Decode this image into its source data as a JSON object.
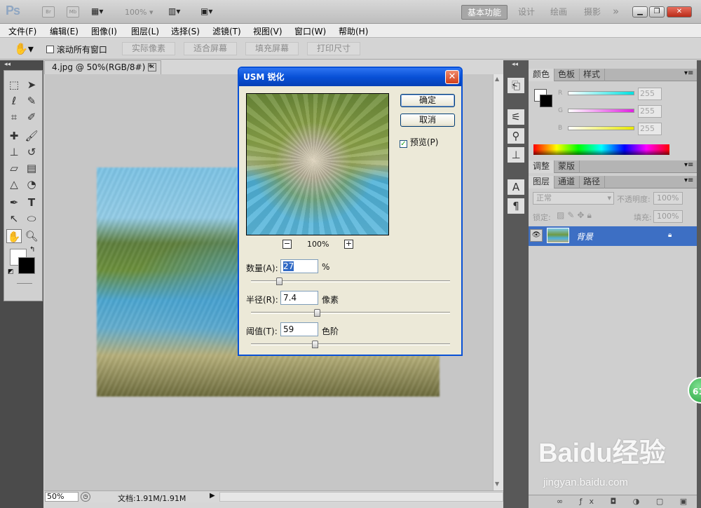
{
  "appbar": {
    "logo": "Ps",
    "icon_br": "Br",
    "icon_mb": "Mb",
    "zoom_level": "100%",
    "workspaces": [
      "基本功能",
      "设计",
      "绘画",
      "摄影"
    ],
    "more": "»"
  },
  "menus": [
    "文件(F)",
    "编辑(E)",
    "图像(I)",
    "图层(L)",
    "选择(S)",
    "滤镜(T)",
    "视图(V)",
    "窗口(W)",
    "帮助(H)"
  ],
  "options": {
    "scroll_all_label": "滚动所有窗口",
    "buttons": [
      "实际像素",
      "适合屏幕",
      "填充屏幕",
      "打印尺寸"
    ]
  },
  "document": {
    "tab_title": "4.jpg @ 50%(RGB/8#) *",
    "zoom": "50%",
    "info": "文档:1.91M/1.91M"
  },
  "dialog": {
    "title": "USM 锐化",
    "ok": "确定",
    "cancel": "取消",
    "preview_label": "预览(P)",
    "preview_checked": true,
    "preview_zoom": "100%",
    "zoom_out": "−",
    "zoom_in": "+",
    "amount_label": "数量(A):",
    "amount_value": "27",
    "amount_unit": "%",
    "amount_fraction": 0.14,
    "radius_label": "半径(R):",
    "radius_value": "7.4",
    "radius_unit": "像素",
    "radius_fraction": 0.33,
    "threshold_label": "阈值(T):",
    "threshold_value": "59",
    "threshold_unit": "色阶",
    "threshold_fraction": 0.32
  },
  "color_panel": {
    "tabs": [
      "颜色",
      "色板",
      "样式"
    ],
    "channels": [
      {
        "name": "R",
        "value": "255",
        "color": "#00e0e0"
      },
      {
        "name": "G",
        "value": "255",
        "color": "#e020e0"
      },
      {
        "name": "B",
        "value": "255",
        "color": "#e8e800"
      }
    ]
  },
  "adjust_panel": {
    "tabs": [
      "调整",
      "蒙版"
    ]
  },
  "layers_panel": {
    "tabs": [
      "图层",
      "通道",
      "路径"
    ],
    "blend_mode": "正常",
    "opacity_label": "不透明度:",
    "opacity_value": "100%",
    "lock_label": "锁定:",
    "fill_label": "填充:",
    "fill_value": "100%",
    "layer_name": "背景"
  },
  "watermark": {
    "logo": "Baidu经验",
    "url": "jingyan.baidu.com",
    "badge": "61"
  },
  "colors": {
    "dialog_title": "#0850d6",
    "layer_selected": "#3d6fc4"
  }
}
